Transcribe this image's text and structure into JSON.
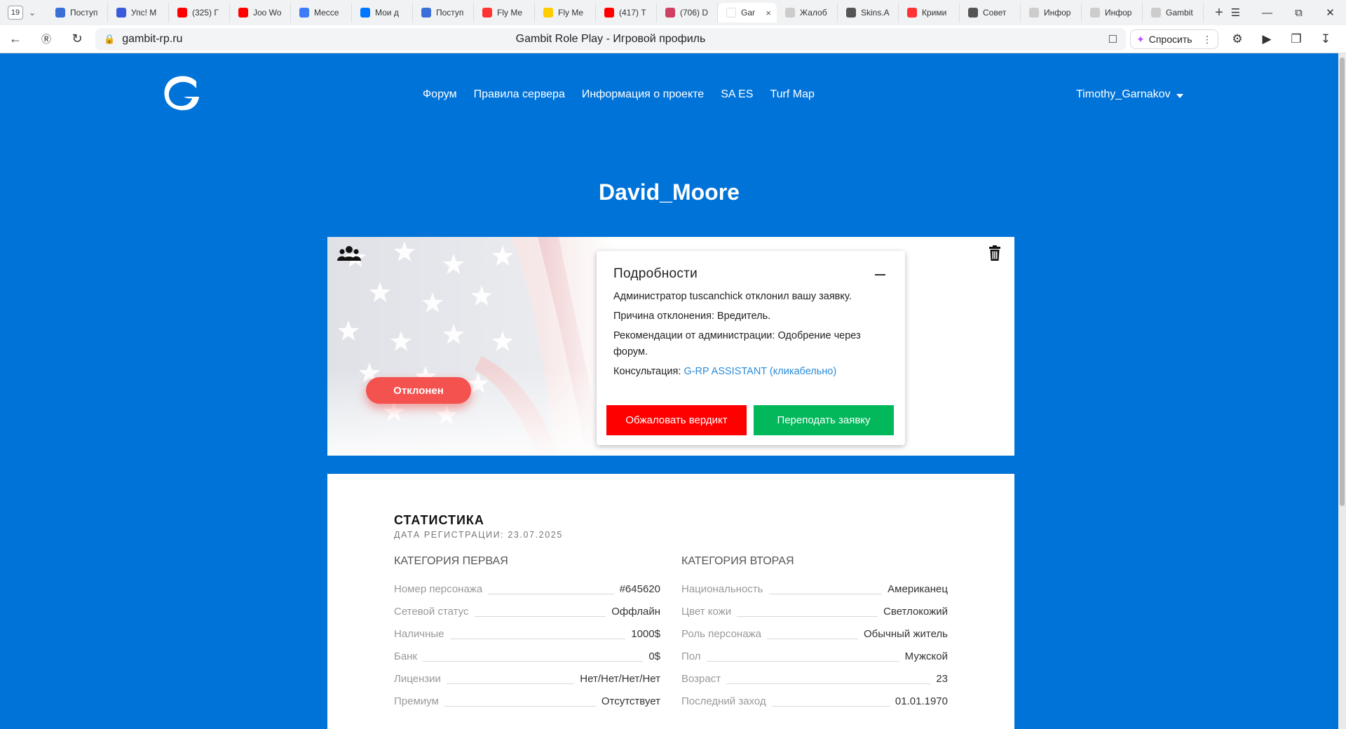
{
  "browser": {
    "tab_count": "19",
    "tabs": [
      {
        "label": "Поступ",
        "color": "#3a6fd8"
      },
      {
        "label": "Упс! М",
        "color": "#3b5bdb"
      },
      {
        "label": "(325) Г",
        "color": "#ff0000"
      },
      {
        "label": "Joo Wo",
        "color": "#ff0000"
      },
      {
        "label": "Мессе",
        "color": "#3d7bf7"
      },
      {
        "label": "Мои д",
        "color": "#0077ff"
      },
      {
        "label": "Поступ",
        "color": "#3a6fd8"
      },
      {
        "label": "Fly Me",
        "color": "#f33"
      },
      {
        "label": "Fly Me",
        "color": "#ffcc00"
      },
      {
        "label": "(417) Т",
        "color": "#ff0000"
      },
      {
        "label": "(706) D",
        "color": "#d04060"
      },
      {
        "label": "Gar",
        "color": "#ffffff",
        "active": true
      },
      {
        "label": "Жалоб",
        "color": "#cccccc"
      },
      {
        "label": "Skins.A",
        "color": "#555555"
      },
      {
        "label": "Крими",
        "color": "#f33"
      },
      {
        "label": "Совет",
        "color": "#555555"
      },
      {
        "label": "Инфор",
        "color": "#cccccc"
      },
      {
        "label": "Инфор",
        "color": "#cccccc"
      },
      {
        "label": "Gambit",
        "color": "#cccccc"
      }
    ],
    "url": "gambit-rp.ru",
    "page_title": "Gambit Role Play - Игровой профиль",
    "ask_label": "Спросить"
  },
  "nav": {
    "items": [
      "Форум",
      "Правила сервера",
      "Информация о проекте",
      "SA ES",
      "Turf Map"
    ],
    "user": "Timothy_Garnakov"
  },
  "profile": {
    "name": "David_Moore",
    "status": "Отклонен"
  },
  "details": {
    "title": "Подробности",
    "line1": "Администратор tuscanchick отклонил вашу заявку.",
    "line2": "Причина отклонения: Вредитель.",
    "line3": "Рекомендации от администрации: Одобрение через форум.",
    "line4_prefix": "Консультация: ",
    "line4_link": "G-RP ASSISTANT (кликабельно)",
    "appeal_label": "Обжаловать вердикт",
    "resubmit_label": "Переподать заявку"
  },
  "stats": {
    "title": "СТАТИСТИКА",
    "registration": "ДАТА РЕГИСТРАЦИИ: 23.07.2025",
    "cat1": {
      "title": "КАТЕГОРИЯ ПЕРВАЯ",
      "rows": [
        {
          "k": "Номер персонажа",
          "v": "#645620"
        },
        {
          "k": "Сетевой статус",
          "v": "Оффлайн"
        },
        {
          "k": "Наличные",
          "v": "1000$"
        },
        {
          "k": "Банк",
          "v": "0$"
        },
        {
          "k": "Лицензии",
          "v": "Нет/Нет/Нет/Нет"
        },
        {
          "k": "Премиум",
          "v": "Отсутствует"
        }
      ]
    },
    "cat2": {
      "title": "КАТЕГОРИЯ ВТОРАЯ",
      "rows": [
        {
          "k": "Национальность",
          "v": "Американец"
        },
        {
          "k": "Цвет кожи",
          "v": "Светлокожий"
        },
        {
          "k": "Роль персонажа",
          "v": "Обычный житель"
        },
        {
          "k": "Пол",
          "v": "Мужской"
        },
        {
          "k": "Возраст",
          "v": "23"
        },
        {
          "k": "Последний заход",
          "v": "01.01.1970"
        }
      ]
    }
  },
  "colors": {
    "brand_blue": "#0073d9",
    "reject_red": "#f3524f",
    "appeal_red": "#ff0000",
    "resubmit_green": "#02b85a",
    "link_blue": "#2a8bd8"
  }
}
